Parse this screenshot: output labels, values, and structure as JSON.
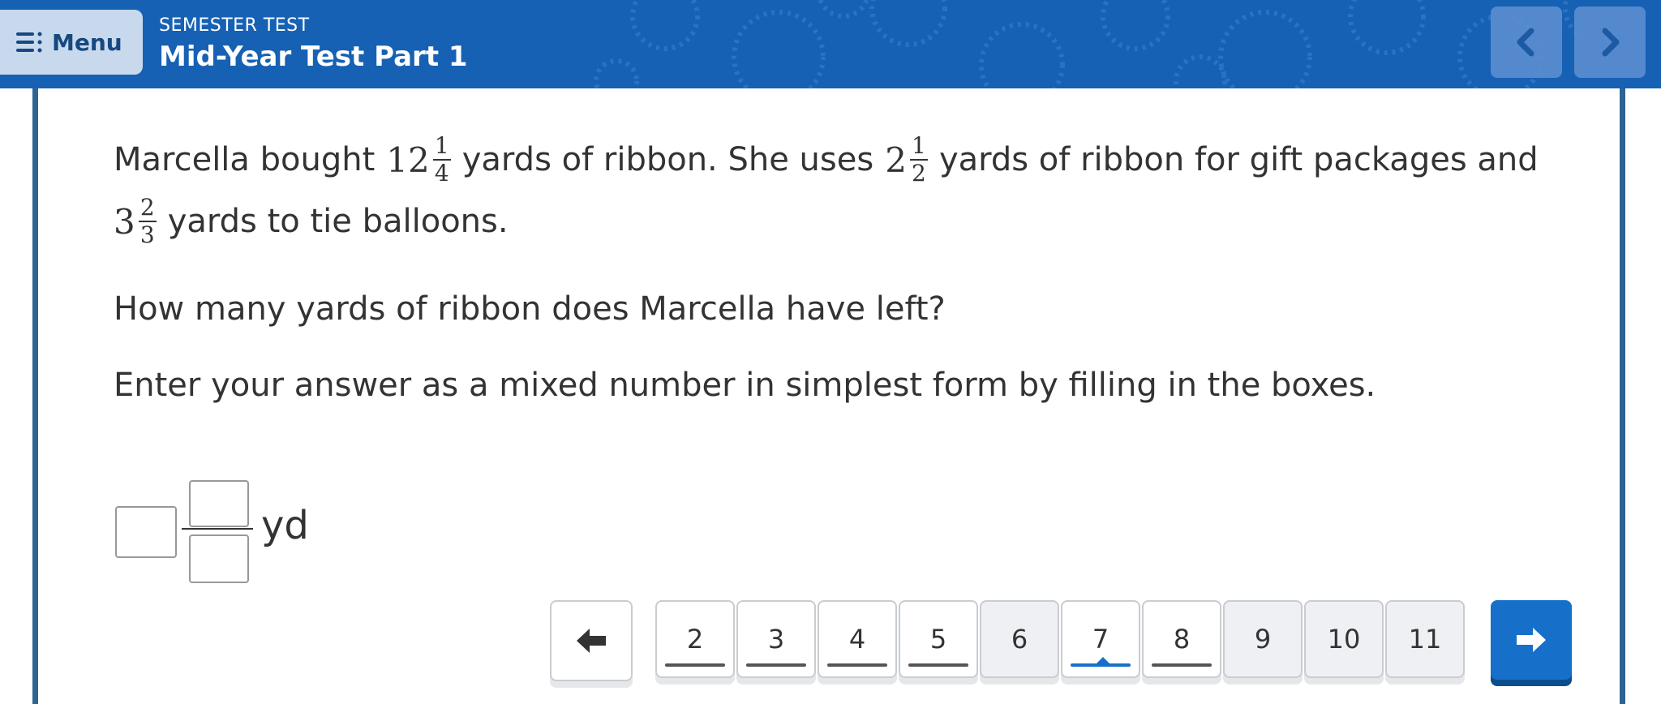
{
  "header": {
    "menu_label": "Menu",
    "subtitle": "SEMESTER TEST",
    "title": "Mid-Year Test Part 1",
    "bg_color": "#1661b4"
  },
  "question": {
    "line1_a": "Marcella bought",
    "m1": {
      "whole": "12",
      "num": "1",
      "den": "4"
    },
    "line1_b": "yards of ribbon. She uses",
    "m2": {
      "whole": "2",
      "num": "1",
      "den": "2"
    },
    "line1_c": "yards of ribbon for gift packages and",
    "m3": {
      "whole": "3",
      "num": "2",
      "den": "3"
    },
    "line2_b": "yards to tie balloons.",
    "prompt": "How many yards of ribbon does Marcella have left?",
    "instructions": "Enter your answer as a mixed number in simplest form by filling in the boxes."
  },
  "answer": {
    "unit": "yd",
    "whole_value": "",
    "numerator_value": "",
    "denominator_value": ""
  },
  "pager": {
    "pages": [
      {
        "label": "2",
        "state": "visited"
      },
      {
        "label": "3",
        "state": "visited"
      },
      {
        "label": "4",
        "state": "visited"
      },
      {
        "label": "5",
        "state": "visited"
      },
      {
        "label": "6",
        "state": "unvisited"
      },
      {
        "label": "7",
        "state": "current"
      },
      {
        "label": "8",
        "state": "visited"
      },
      {
        "label": "9",
        "state": "unvisited"
      },
      {
        "label": "10",
        "state": "unvisited"
      },
      {
        "label": "11",
        "state": "unvisited"
      }
    ],
    "prev_icon": "arrow-left-icon",
    "next_icon": "arrow-right-icon",
    "next_color": "#1670c9"
  }
}
